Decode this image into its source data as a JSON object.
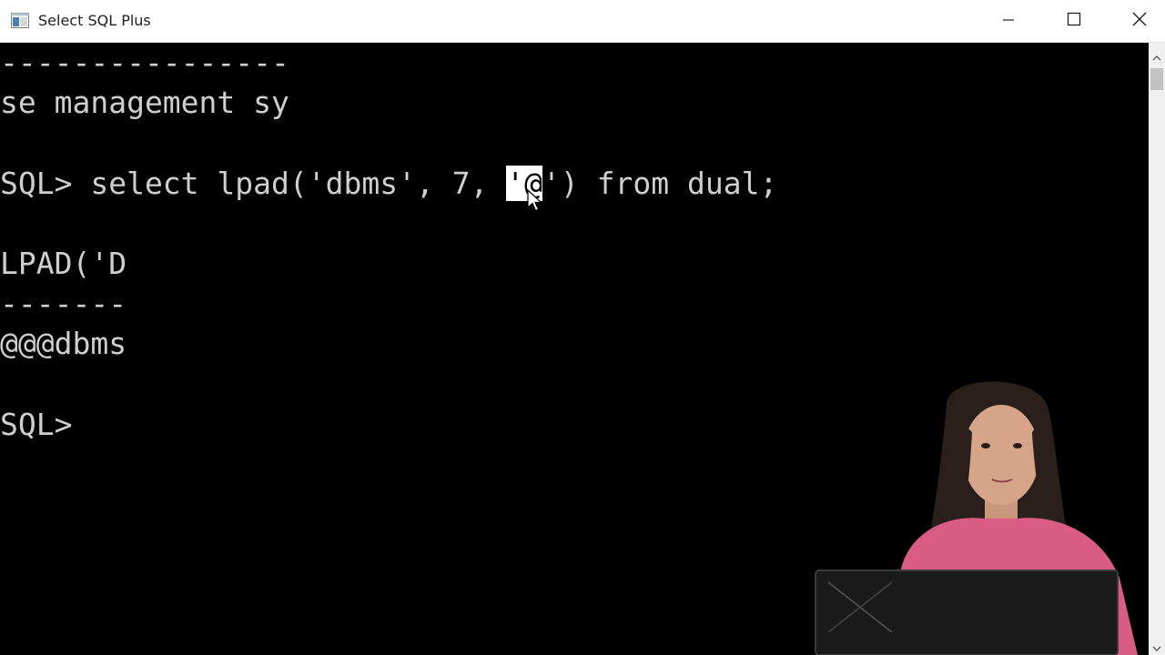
{
  "window": {
    "title": "Select SQL Plus",
    "icon": "console-window-icon",
    "controls": [
      "minimize-icon",
      "maximize-icon",
      "close-icon"
    ]
  },
  "console": {
    "lines": [
      "----------------",
      "se management sy",
      "SQL> select lpad('dbms', 7, ",
      "LPAD('D",
      "-------",
      "@@@dbms",
      "SQL> "
    ],
    "selected_text": "'@",
    "after_selection": "') from dual;"
  },
  "colors": {
    "console_bg": "#000000",
    "console_text": "#cfcfcf",
    "selection_bg": "#ffffff",
    "titlebar_bg": "#ffffff"
  }
}
